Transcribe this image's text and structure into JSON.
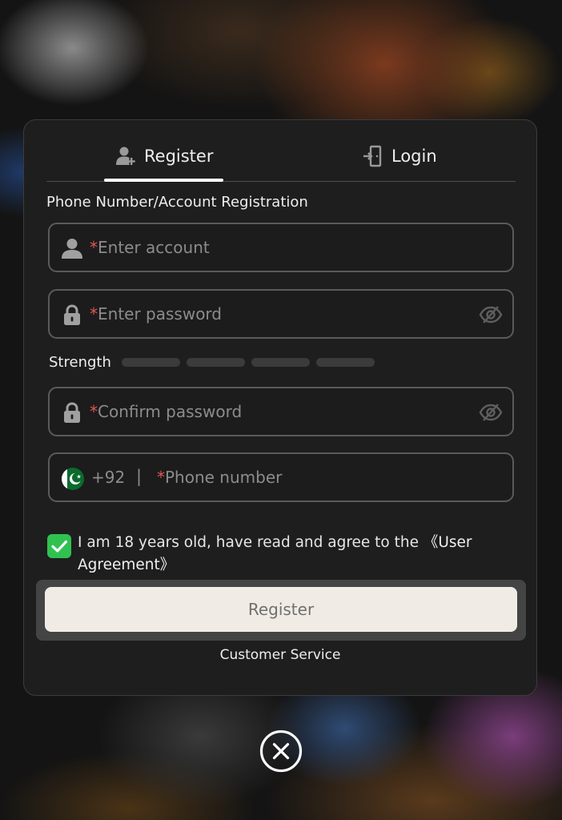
{
  "tabs": {
    "register": "Register",
    "login": "Login",
    "register_icon": "user-plus-icon",
    "login_icon": "door-enter-icon"
  },
  "form": {
    "section_title": "Phone Number/Account Registration",
    "required_mark": "*",
    "account_placeholder": "Enter account",
    "password_placeholder": "Enter password",
    "confirm_placeholder": "Confirm password",
    "strength_label": "Strength",
    "strength_level": 0,
    "strength_segments": 4,
    "phone_country_code": "+92",
    "phone_separator": "|",
    "phone_placeholder": "Phone number",
    "country_flag": "pakistan-flag-icon"
  },
  "agreement": {
    "checked": true,
    "text": "I am 18 years old,  have read and agree to the  ",
    "link": "《User Agreement》"
  },
  "actions": {
    "register_button": "Register",
    "customer_service": "Customer Service"
  },
  "colors": {
    "accent_green": "#2fc251",
    "required_red": "#e0584e",
    "button_bg": "#f0ece5",
    "dialog_bg": "#1e1e1e"
  }
}
